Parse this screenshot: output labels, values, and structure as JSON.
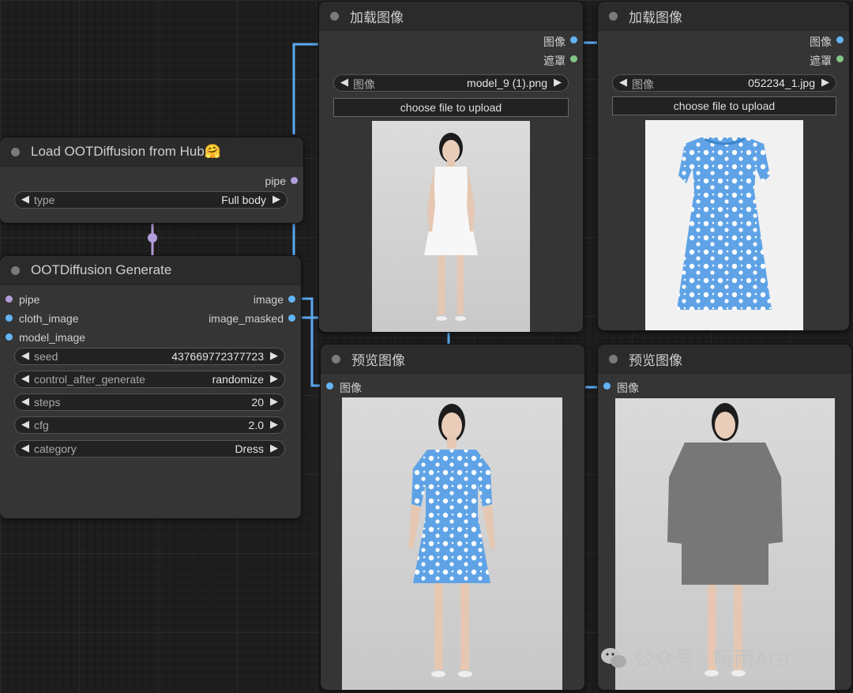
{
  "nodes": {
    "load_image_1": {
      "title": "加载图像",
      "outputs": [
        "图像",
        "遮罩"
      ],
      "image_label": "图像",
      "image_value": "model_9 (1).png",
      "upload_label": "choose file to upload"
    },
    "load_image_2": {
      "title": "加载图像",
      "outputs": [
        "图像",
        "遮罩"
      ],
      "image_label": "图像",
      "image_value": "052234_1.jpg",
      "upload_label": "choose file to upload"
    },
    "load_ootd": {
      "title": "Load OOTDiffusion from Hub🤗",
      "output": "pipe",
      "type_label": "type",
      "type_value": "Full body"
    },
    "ootd_generate": {
      "title": "OOTDiffusion Generate",
      "inputs": [
        "pipe",
        "cloth_image",
        "model_image"
      ],
      "outputs": [
        "image",
        "image_masked"
      ],
      "widgets": [
        {
          "label": "seed",
          "value": "437669772377723"
        },
        {
          "label": "control_after_generate",
          "value": "randomize"
        },
        {
          "label": "steps",
          "value": "20"
        },
        {
          "label": "cfg",
          "value": "2.0"
        },
        {
          "label": "category",
          "value": "Dress"
        }
      ]
    },
    "preview_1": {
      "title": "预览图像",
      "input": "图像"
    },
    "preview_2": {
      "title": "预览图像",
      "input": "图像"
    }
  },
  "watermark": "公众号 · 听雨AGI",
  "colors": {
    "image_socket": "#64b5f6",
    "mask_socket": "#81c784",
    "pipe_socket": "#b39ddb"
  }
}
